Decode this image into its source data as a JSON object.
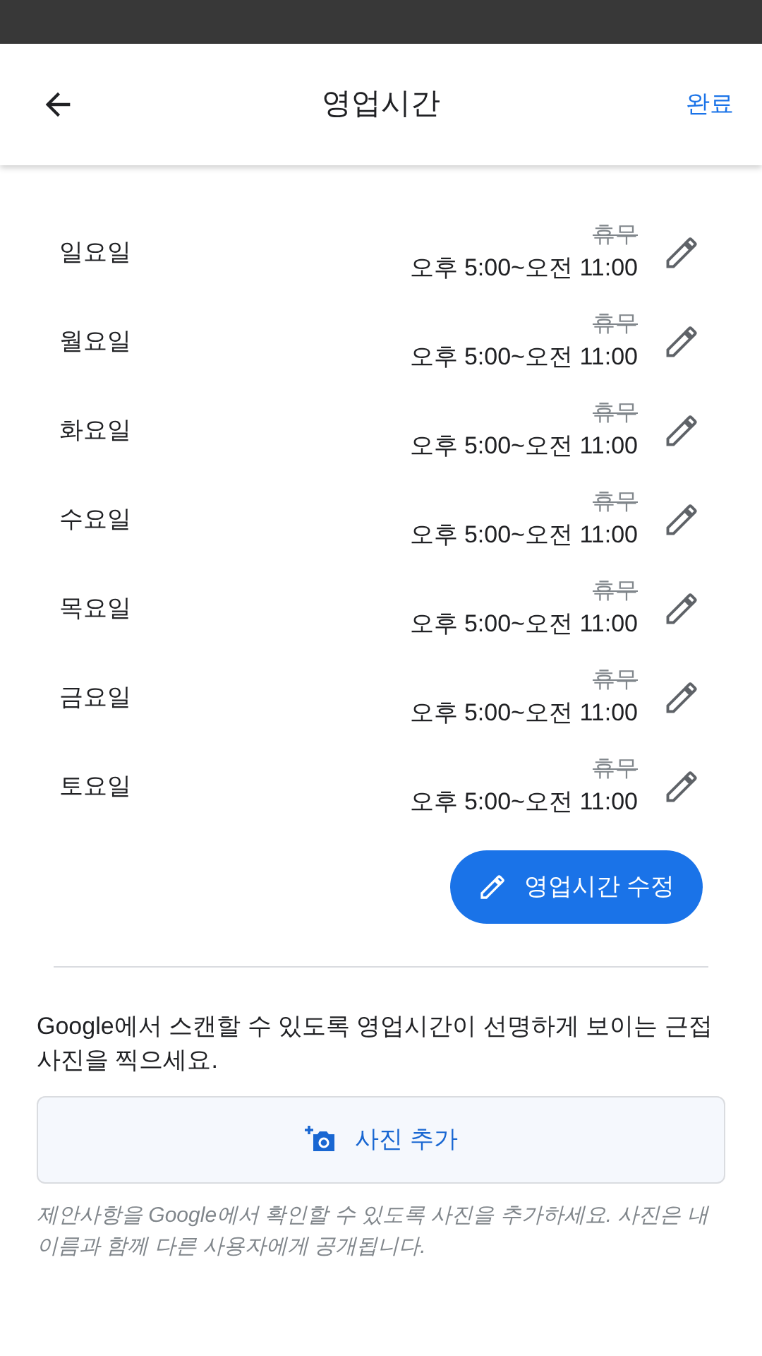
{
  "header": {
    "title": "영업시간",
    "done": "완료"
  },
  "days": [
    {
      "day": "일요일",
      "previous": "휴무",
      "hours": "오후 5:00~오전 11:00"
    },
    {
      "day": "월요일",
      "previous": "휴무",
      "hours": "오후 5:00~오전 11:00"
    },
    {
      "day": "화요일",
      "previous": "휴무",
      "hours": "오후 5:00~오전 11:00"
    },
    {
      "day": "수요일",
      "previous": "휴무",
      "hours": "오후 5:00~오전 11:00"
    },
    {
      "day": "목요일",
      "previous": "휴무",
      "hours": "오후 5:00~오전 11:00"
    },
    {
      "day": "금요일",
      "previous": "휴무",
      "hours": "오후 5:00~오전 11:00"
    },
    {
      "day": "토요일",
      "previous": "휴무",
      "hours": "오후 5:00~오전 11:00"
    }
  ],
  "edit_button": "영업시간 수정",
  "photo_prompt": "Google에서 스캔할 수 있도록 영업시간이 선명하게 보이는 근접 사진을 찍으세요.",
  "add_photo_button": "사진 추가",
  "disclaimer": "제안사항을 Google에서 확인할 수 있도록 사진을 추가하세요. 사진은 내 이름과 함께 다른 사용자에게 공개됩니다."
}
